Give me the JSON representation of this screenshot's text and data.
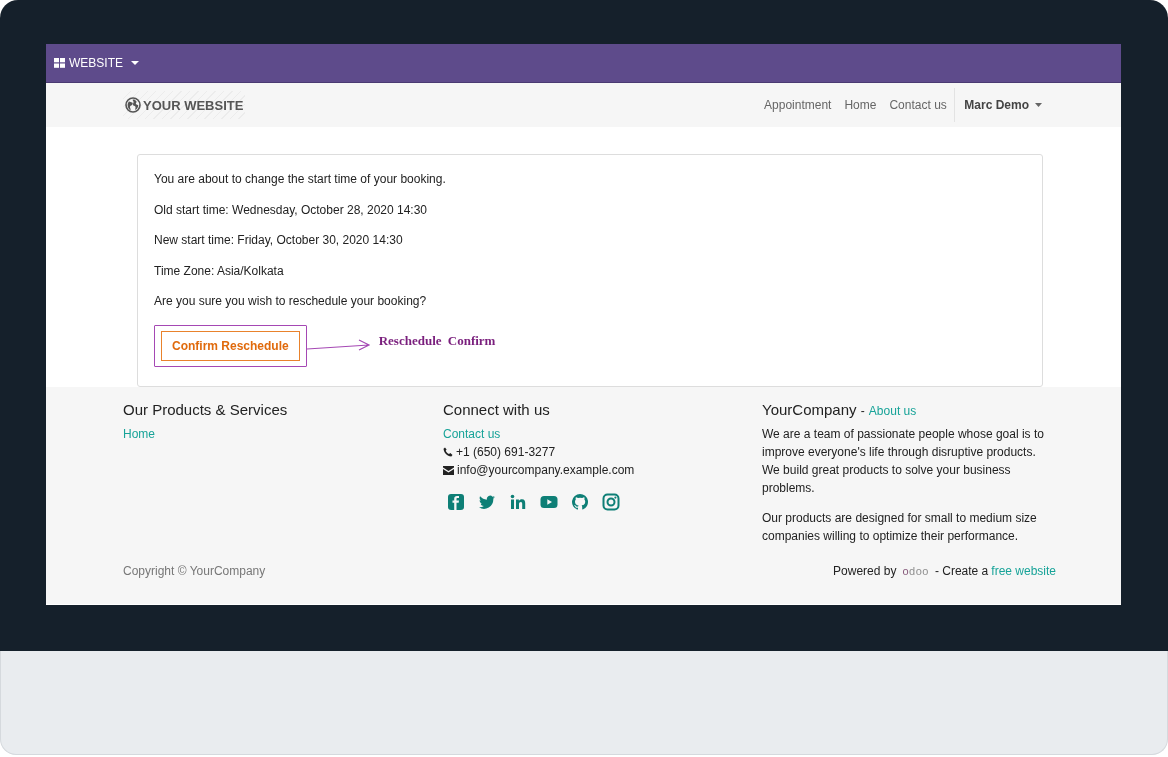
{
  "admin_bar": {
    "app_menu": "WEBSITE"
  },
  "navbar": {
    "logo": "YOUR WEBSITE",
    "links": [
      {
        "label": "Appointment"
      },
      {
        "label": "Home"
      },
      {
        "label": "Contact us"
      }
    ],
    "user": "Marc Demo"
  },
  "booking": {
    "lines": [
      "You are about to change the start time of your booking.",
      "Old start time: Wednesday, October 28, 2020 14:30",
      "New start time: Friday, October 30, 2020 14:30",
      "Time Zone: Asia/Kolkata",
      "Are you sure you wish to reschedule your booking?"
    ],
    "button": "Confirm Reschedule"
  },
  "annotation": {
    "label": "Reschedule Confirm"
  },
  "footer": {
    "products": {
      "title": "Our Products & Services",
      "links": [
        "Home"
      ]
    },
    "connect": {
      "title": "Connect with us",
      "link": "Contact us",
      "phone": "+1 (650) 691-3277",
      "email": "info@yourcompany.example.com"
    },
    "about": {
      "title": "YourCompany",
      "separator": "-",
      "link": "About us",
      "paragraphs": [
        "We are a team of passionate people whose goal is to improve everyone's life through disruptive products. We build great products to solve your business problems.",
        "Our products are designed for small to medium size companies willing to optimize their performance."
      ]
    },
    "copyright": "Copyright © YourCompany",
    "powered": {
      "prefix": "Powered by",
      "brand": "odoo",
      "middle": "- Create a",
      "link": "free website"
    }
  }
}
